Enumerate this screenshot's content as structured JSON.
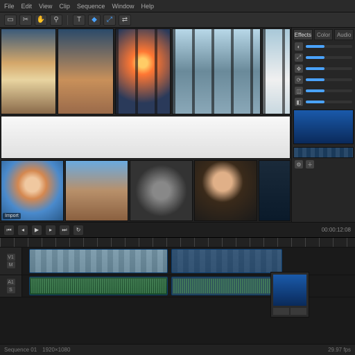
{
  "menu": {
    "items": [
      "File",
      "Edit",
      "View",
      "Clip",
      "Sequence",
      "Window",
      "Help"
    ]
  },
  "toolbar": {
    "buttons": [
      {
        "name": "selection-tool",
        "glyph": "▭"
      },
      {
        "name": "razor-tool",
        "glyph": "✂"
      },
      {
        "name": "hand-tool",
        "glyph": "✋"
      },
      {
        "name": "zoom-tool",
        "glyph": "⚲"
      },
      {
        "name": "text-tool",
        "glyph": "T"
      },
      {
        "name": "marker-tool",
        "glyph": "◆",
        "accent": true
      },
      {
        "name": "snap-toggle",
        "glyph": "⤢",
        "accent": true
      },
      {
        "name": "link-toggle",
        "glyph": "⇄"
      }
    ]
  },
  "media": {
    "row1": [
      {
        "name": "clip-beach-a",
        "label": "",
        "cls": "sky1"
      },
      {
        "name": "clip-beach-b",
        "label": "",
        "cls": "sky2"
      },
      {
        "name": "clip-sunset",
        "label": "",
        "cls": "sunset pillars"
      },
      {
        "name": "clip-sea-wide",
        "label": "",
        "cls": "sea pillars"
      },
      {
        "name": "clip-sea-tall",
        "label": "",
        "cls": "seatall pillars"
      }
    ],
    "row2": [
      {
        "name": "clip-white",
        "label": "",
        "cls": "whiteclip"
      }
    ],
    "row3": [
      {
        "name": "clip-girl",
        "label": "Import",
        "cls": "girl"
      },
      {
        "name": "clip-desert",
        "label": "",
        "cls": "desert"
      },
      {
        "name": "clip-robot",
        "label": "",
        "cls": "robot"
      },
      {
        "name": "clip-man",
        "label": "",
        "cls": "man"
      },
      {
        "name": "clip-dark",
        "label": "",
        "cls": "dark"
      }
    ]
  },
  "inspector": {
    "tabs": [
      "Effects",
      "Color",
      "Audio"
    ],
    "active_tab": 0,
    "props": [
      {
        "name": "opacity",
        "icon": "◐"
      },
      {
        "name": "scale",
        "icon": "⤢"
      },
      {
        "name": "position",
        "icon": "✥"
      },
      {
        "name": "rotation",
        "icon": "⟳"
      },
      {
        "name": "crop",
        "icon": "◫"
      },
      {
        "name": "blend",
        "icon": "◧"
      }
    ]
  },
  "transport": {
    "buttons": [
      {
        "name": "goto-start",
        "glyph": "⏮"
      },
      {
        "name": "step-back",
        "glyph": "◂"
      },
      {
        "name": "play",
        "glyph": "▶"
      },
      {
        "name": "step-fwd",
        "glyph": "▸"
      },
      {
        "name": "goto-end",
        "glyph": "⏭"
      },
      {
        "name": "loop",
        "glyph": "↻"
      }
    ],
    "timecode": "00:00:12:08"
  },
  "timeline": {
    "tracks": [
      {
        "name": "V1",
        "type": "video",
        "clips": [
          "v1",
          "v2"
        ]
      },
      {
        "name": "A1",
        "type": "audio",
        "clips": [
          "a1",
          "a2"
        ]
      }
    ]
  },
  "status": {
    "left": "Sequence 01",
    "mid": "1920×1080",
    "right": "29.97 fps"
  },
  "colors": {
    "accent": "#4aa3ff",
    "bg": "#1a1a1a",
    "panel": "#262626"
  }
}
